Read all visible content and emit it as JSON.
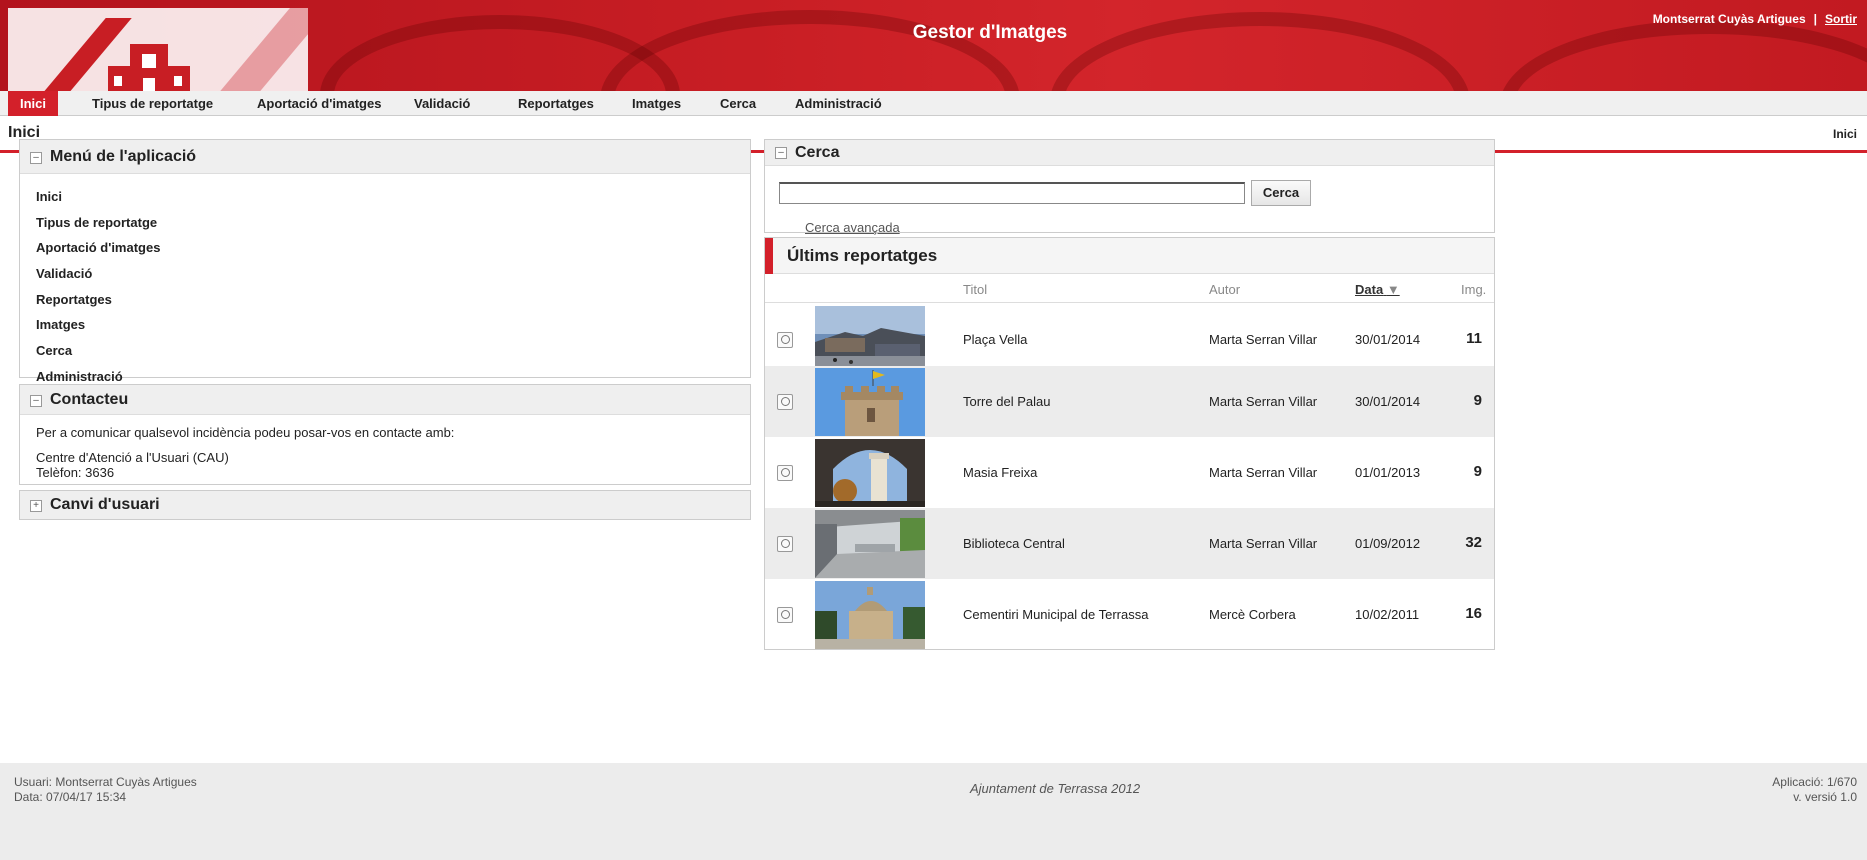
{
  "header": {
    "app_title": "Gestor d'Imatges",
    "user_name": "Montserrat Cuyàs Artigues",
    "separator": "|",
    "logout": "Sortir"
  },
  "nav": {
    "items": [
      {
        "label": "Inici"
      },
      {
        "label": "Tipus de reportatge"
      },
      {
        "label": "Aportació d'imatges"
      },
      {
        "label": "Validació"
      },
      {
        "label": "Reportatges"
      },
      {
        "label": "Imatges"
      },
      {
        "label": "Cerca"
      },
      {
        "label": "Administració"
      }
    ],
    "active_index": 0
  },
  "page": {
    "title": "Inici",
    "breadcrumb": "Inici"
  },
  "menu_panel": {
    "title": "Menú de l'aplicació",
    "items": [
      "Inici",
      "Tipus de reportatge",
      "Aportació d'imatges",
      "Validació",
      "Reportatges",
      "Imatges",
      "Cerca",
      "Administració"
    ]
  },
  "contact_panel": {
    "title": "Contacteu",
    "text": "Per a comunicar qualsevol incidència podeu posar-vos en contacte amb:",
    "center": "Centre d'Atenció a l'Usuari (CAU)",
    "phone": "Telèfon: 3636"
  },
  "user_change_panel": {
    "title": "Canvi d'usuari"
  },
  "search_panel": {
    "title": "Cerca",
    "input_value": "",
    "button": "Cerca",
    "advanced_link": "Cerca avançada"
  },
  "reports_panel": {
    "title": "Últims reportatges",
    "columns": {
      "title": "Titol",
      "author": "Autor",
      "date": "Data",
      "images": "Img."
    },
    "sort_indicator": "▼",
    "rows": [
      {
        "title": "Plaça Vella",
        "author": "Marta Serran Villar",
        "date": "30/01/2014",
        "images": "11"
      },
      {
        "title": "Torre del Palau",
        "author": "Marta Serran Villar",
        "date": "30/01/2014",
        "images": "9"
      },
      {
        "title": "Masia Freixa",
        "author": "Marta Serran Villar",
        "date": "01/01/2013",
        "images": "9"
      },
      {
        "title": "Biblioteca Central",
        "author": "Marta Serran Villar",
        "date": "01/09/2012",
        "images": "32"
      },
      {
        "title": "Cementiri Municipal de Terrassa",
        "author": "Mercè Corbera",
        "date": "10/02/2011",
        "images": "16"
      }
    ]
  },
  "footer": {
    "user": "Usuari: Montserrat Cuyàs Artigues",
    "date": "Data: 07/04/17 15:34",
    "center": "Ajuntament de Terrassa 2012",
    "app": "Aplicació: 1/670",
    "version": "v. versió 1.0"
  },
  "colors": {
    "brand_red": "#d3202a",
    "nav_bg": "#f0f0f0",
    "panel_head_bg": "#efefef"
  }
}
